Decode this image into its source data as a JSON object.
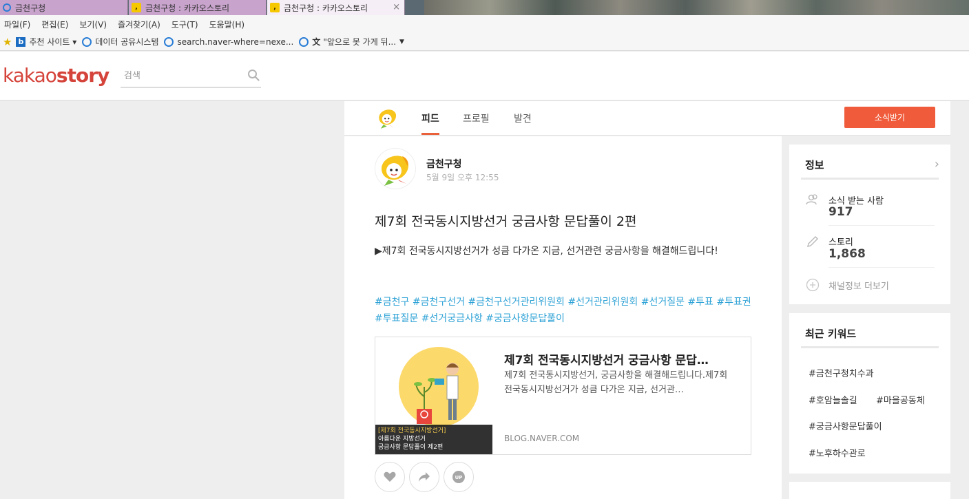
{
  "browser": {
    "tabs": [
      {
        "label": "금천구청",
        "icon": "ie-icon"
      },
      {
        "label": "금천구청 : 카카오스토리",
        "icon": "kakaostory-icon"
      },
      {
        "label": "금천구청 : 카카오스토리",
        "icon": "kakaostory-icon",
        "active": true,
        "close": "×"
      }
    ],
    "menu": [
      "파일(F)",
      "편집(E)",
      "보기(V)",
      "즐겨찾기(A)",
      "도구(T)",
      "도움말(H)"
    ],
    "favorites": [
      {
        "label": "추천 사이트 ▾",
        "icon": "bing-icon"
      },
      {
        "label": "데이터 공유시스템",
        "icon": "ie-page-icon"
      },
      {
        "label": "search.naver-where=nexe...",
        "icon": "ie-page-icon"
      },
      {
        "label": "\"앞으로 못 가게 뒤...",
        "icon": "translate-icon"
      }
    ]
  },
  "header": {
    "logo_left": "kakao",
    "logo_right": "story",
    "search_placeholder": "검색"
  },
  "profile_nav": {
    "tabs": [
      "피드",
      "프로필",
      "발견"
    ],
    "active_tab": "피드",
    "subscribe_label": "소식받기"
  },
  "post": {
    "author": "금천구청",
    "date": "5월 9일 오후 12:55",
    "title": "제7회 전국동시지방선거 궁금사항 문답풀이 2편",
    "body": "▶제7회 전국동시지방선거가 성큼 다가온 지금, 선거관련 궁금사항을 해결해드립니다!",
    "tags": "#금천구 #금천구선거 #금천구선거관리위원회 #선거관리위원회 #선거질문 #투표 #투표권 #투표질문 #선거궁금사항 #궁금사항문답풀이",
    "link": {
      "title": "제7회 전국동시지방선거 궁금사항 문답…",
      "desc": "제7회 전국동시지방선거, 궁금사항을 해결해드립니다.제7회 전국동시지방선거가 성큼 다가온 지금, 선거관…",
      "source": "BLOG.NAVER.COM",
      "thumb_caption": [
        "[제7회 전국동시지방선거]",
        "아름다운 지방선거",
        "궁금사항 문답풀이 제2편"
      ]
    },
    "actions": [
      "like-icon",
      "share-icon",
      "up-icon"
    ],
    "up_label": "UP"
  },
  "info": {
    "heading": "정보",
    "subscribers_label": "소식 받는 사람",
    "subscribers_value": "917",
    "stories_label": "스토리",
    "stories_value": "1,868",
    "more_label": "채널정보 더보기"
  },
  "keywords": {
    "heading": "최근 키워드",
    "items": [
      "#금천구청치수과",
      "#호암늘솔길",
      "#마을공동체",
      "#궁금사항문답풀이",
      "#노후하수관로"
    ]
  },
  "colors": {
    "accent": "#f05c3b",
    "logo": "#d5443b",
    "tag": "#2ea2d6"
  }
}
